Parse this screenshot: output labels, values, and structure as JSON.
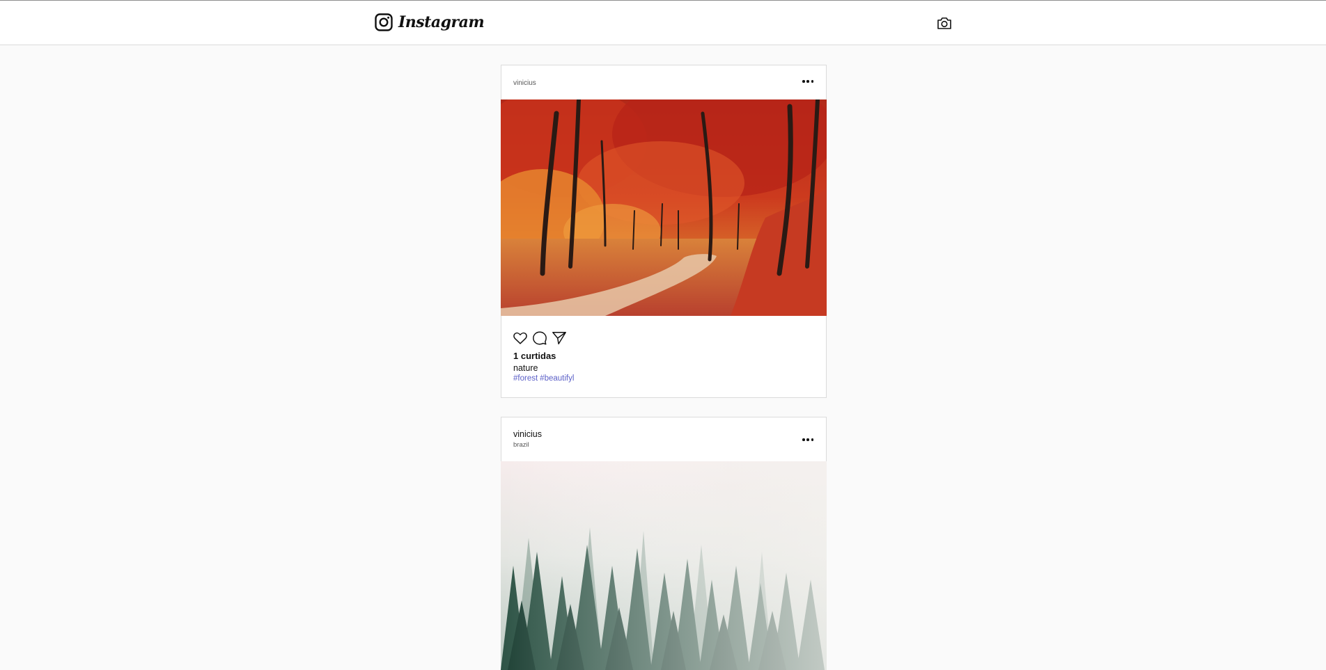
{
  "header": {
    "brand_name": "Instagram",
    "logo_icon": "instagram-glyph-icon",
    "camera_icon": "camera-icon"
  },
  "posts": [
    {
      "author": "vinicius",
      "location": "",
      "image": "autumn-forest-path",
      "likes_text": "1 curtidas",
      "caption": "nature",
      "tags": [
        "#forest",
        "#beautifyl"
      ]
    },
    {
      "author": "vinicius",
      "location": "brazil",
      "image": "misty-pine-forest"
    }
  ],
  "colors": {
    "background": "#fafafa",
    "card": "#ffffff",
    "border": "#dbdbdb",
    "hashtag": "#5b5fc7"
  }
}
